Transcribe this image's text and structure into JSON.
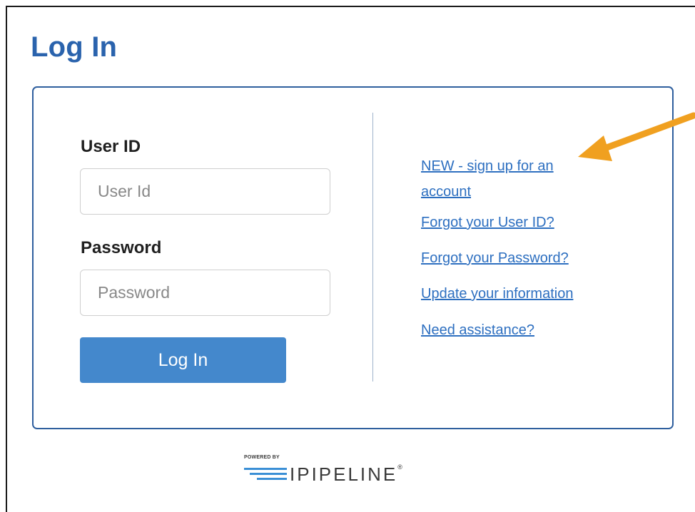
{
  "page": {
    "title": "Log In"
  },
  "form": {
    "user_id_label": "User ID",
    "user_id_placeholder": "User Id",
    "password_label": "Password",
    "password_placeholder": "Password",
    "submit_label": "Log In"
  },
  "links": {
    "signup_line1": "NEW - sign up for an",
    "signup_line2": "account",
    "forgot_user_id": "Forgot your User ID?",
    "forgot_password": "Forgot your Password?",
    "update_info": "Update your information",
    "need_assistance": "Need assistance?"
  },
  "brand": {
    "powered_by": "POWERED BY",
    "name": "IPIPELINE",
    "registered": "®"
  },
  "colors": {
    "title": "#2a63ad",
    "panel_border": "#2f5f9e",
    "button": "#4488cc",
    "link": "#2d6fc0",
    "arrow": "#f0a020"
  }
}
